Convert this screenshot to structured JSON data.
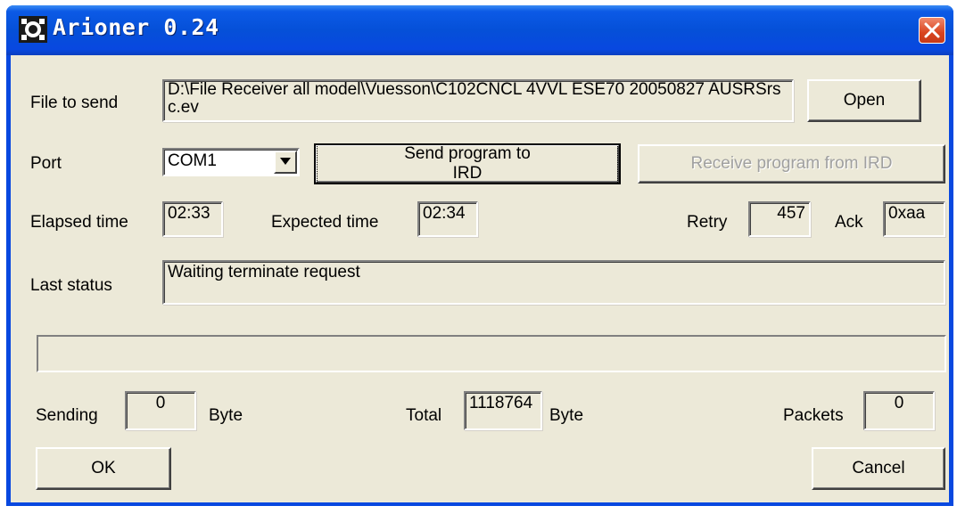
{
  "window": {
    "title": "Arioner 0.24",
    "icon": "arioner-app-icon",
    "close_icon": "close-icon"
  },
  "file": {
    "label": "File to send",
    "value": "D:\\File Receiver all model\\Vuesson\\C102CNCL 4VVL ESE70 20050827 AUSRSrsc.ev",
    "open_button": "Open"
  },
  "port": {
    "label": "Port",
    "selected": "COM1",
    "send_button": "Send program to IRD",
    "receive_button": "Receive program from IRD"
  },
  "timing": {
    "elapsed_label": "Elapsed time",
    "elapsed_value": "02:33",
    "expected_label": "Expected time",
    "expected_value": "02:34",
    "retry_label": "Retry",
    "retry_value": "457",
    "ack_label": "Ack",
    "ack_value": "0xaa"
  },
  "status": {
    "label": "Last status",
    "value": "Waiting terminate request"
  },
  "progress": {
    "fraction": 0
  },
  "counters": {
    "sending_label": "Sending",
    "sending_value": "0",
    "sending_unit": "Byte",
    "total_label": "Total",
    "total_value": "1118764",
    "total_unit": "Byte",
    "packets_label": "Packets",
    "packets_value": "0"
  },
  "footer": {
    "ok_button": "OK",
    "cancel_button": "Cancel"
  },
  "colors": {
    "titlebar": "#0848e0",
    "dialog_bg": "#ece9d8",
    "close_button": "#d9441f"
  }
}
